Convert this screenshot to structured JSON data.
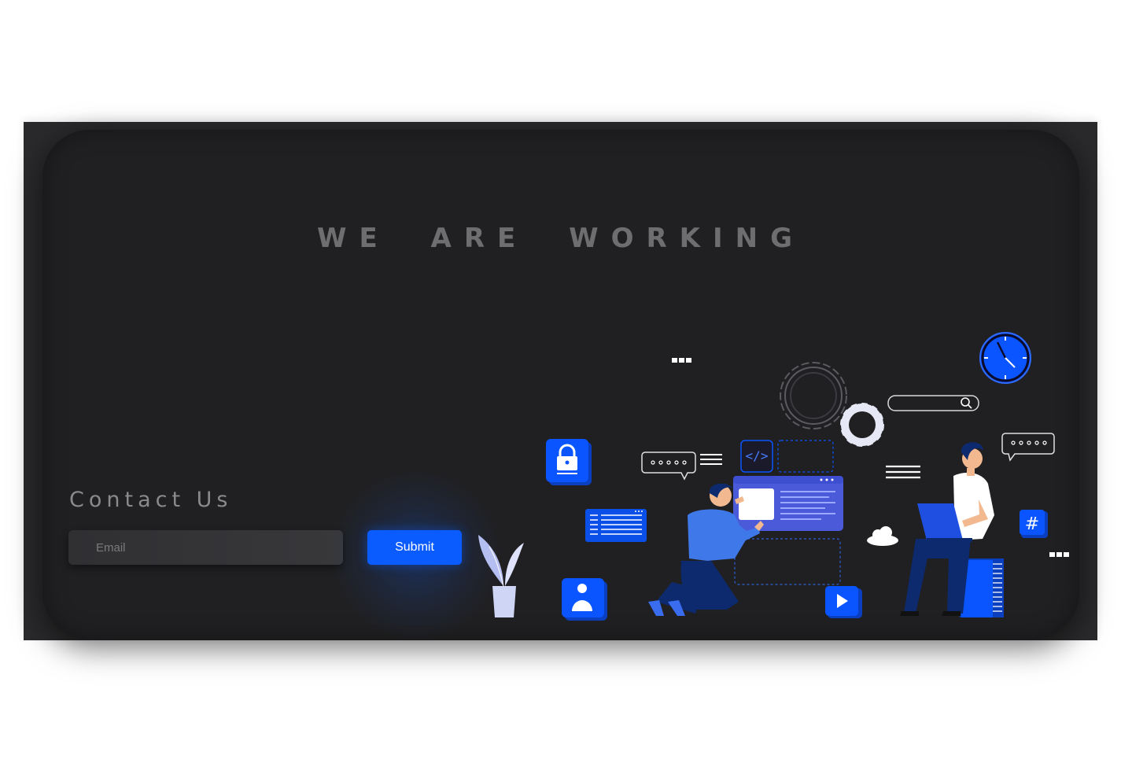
{
  "hero": {
    "title": "WE ARE WORKING"
  },
  "contact": {
    "heading": "Contact Us",
    "email_placeholder": "Email",
    "submit_label": "Submit"
  },
  "colors": {
    "accent": "#0a5cff",
    "panel": "#202022",
    "frame": "#2a2a2c",
    "title": "#6e6e70"
  },
  "illustration": {
    "icons": [
      "lock-icon",
      "user-icon",
      "play-icon",
      "hash-icon",
      "clock-icon",
      "gear-icon",
      "search-icon",
      "cloud-icon",
      "code-icon",
      "chat-bubble-icon",
      "plant-icon"
    ]
  }
}
